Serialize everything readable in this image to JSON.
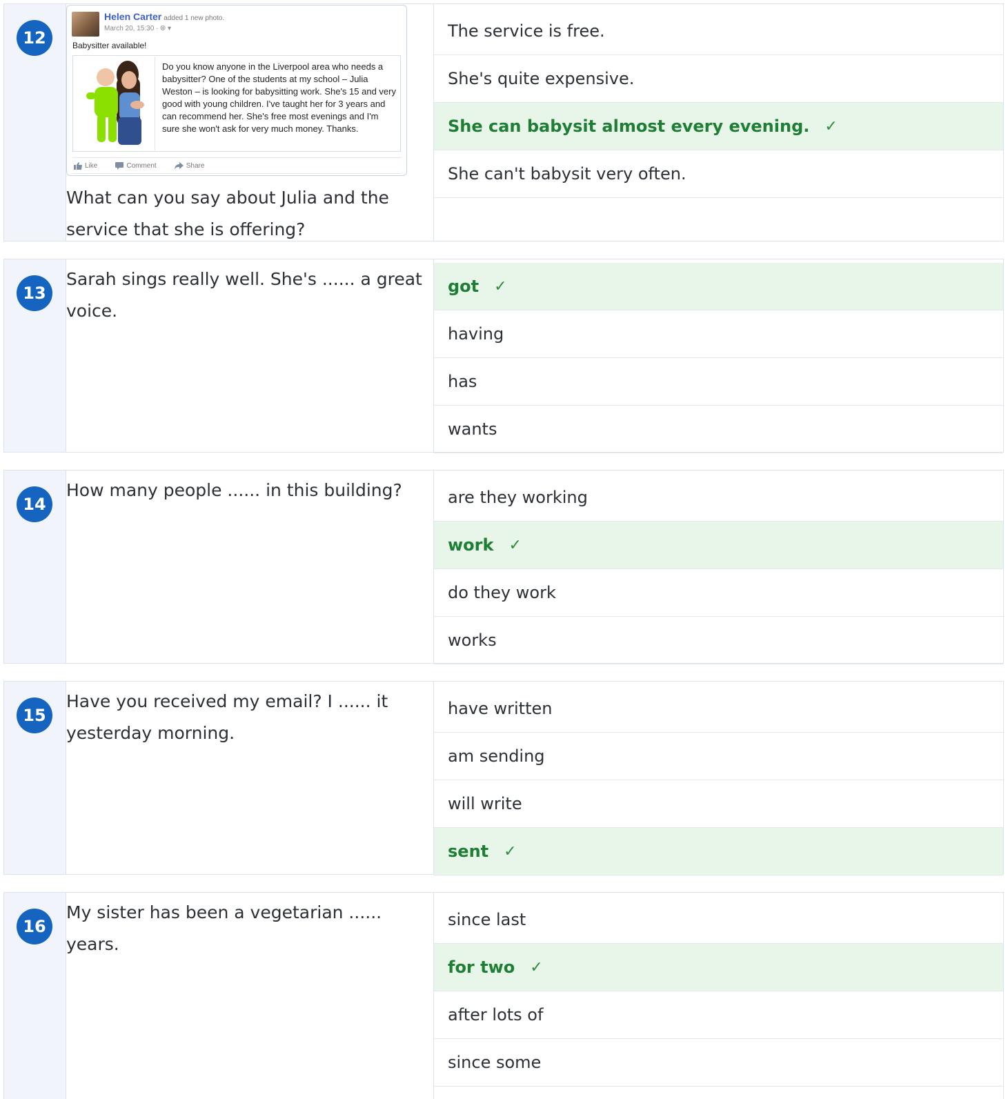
{
  "questions": [
    {
      "number": "12",
      "post": {
        "author": "Helen Carter",
        "action": "added 1 new photo.",
        "date": "March 20, 15:30 ·",
        "title": "Babysitter available!",
        "body": "Do you know anyone in the Liverpool area who needs a babysitter? One of the students at my school – Julia Weston – is looking for babysitting work. She's 15 and very good with young children. I've taught her for 3 years and can recommend her. She's free most evenings and I'm sure she won't ask for very much money. Thanks.",
        "actions": [
          "Like",
          "Comment",
          "Share"
        ]
      },
      "text": "What can you say about Julia and the service that she is offering?",
      "options": [
        "The service is free.",
        "She's quite expensive.",
        "She can babysit almost every evening.",
        "She can't babysit very often."
      ],
      "correct": 2
    },
    {
      "number": "13",
      "text": "Sarah sings really well. She's ...... a great voice.",
      "options": [
        "got",
        "having",
        "has",
        "wants"
      ],
      "correct": 0
    },
    {
      "number": "14",
      "text": "How many people ...... in this building?",
      "options": [
        "are they working",
        "work",
        "do they work",
        "works"
      ],
      "correct": 1
    },
    {
      "number": "15",
      "text": "Have you received my email? I ...... it yesterday morning.",
      "options": [
        "have written",
        "am sending",
        "will write",
        "sent"
      ],
      "correct": 3
    },
    {
      "number": "16",
      "text": "My sister has been a vegetarian ...... years.",
      "options": [
        "since last",
        "for two",
        "after lots of",
        "since some"
      ],
      "correct": 1
    }
  ],
  "check_mark": "✓",
  "colors": {
    "number_badge": "#1565c0",
    "correct_bg": "#e8f5e9",
    "correct_text": "#1e7e34",
    "left_column_bg": "#f1f5fb",
    "border": "#dbe3ec"
  }
}
